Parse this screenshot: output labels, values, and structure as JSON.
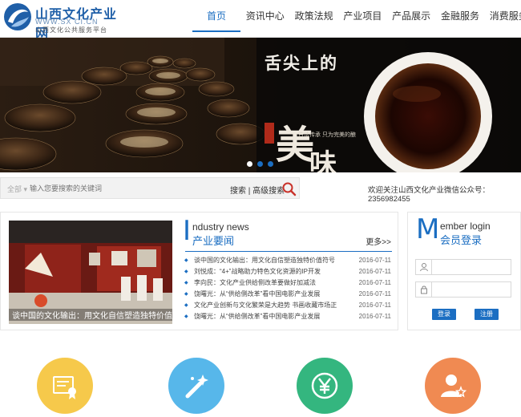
{
  "colors": {
    "accent": "#1b6ec2",
    "circle_yellow": "#f6c94b",
    "circle_blue": "#57b7ea",
    "circle_green": "#34b67f",
    "circle_orange": "#f08a52"
  },
  "header": {
    "logo_cn": "山西文化产业网",
    "logo_url": "WWW.SX CI.CN",
    "logo_sub": "山西文化公共服务平台",
    "nav": [
      {
        "label": "首页",
        "active": true
      },
      {
        "label": "资讯中心"
      },
      {
        "label": "政策法规"
      },
      {
        "label": "产业项目"
      },
      {
        "label": "产品展示"
      },
      {
        "label": "金融服务"
      },
      {
        "label": "消费服务"
      }
    ]
  },
  "banner": {
    "title": "舌尖上的",
    "slogan": "古法传承 只为完美的酿",
    "big1": "美",
    "big2": "味",
    "dots": 3,
    "active_dot": 1
  },
  "search": {
    "category": "全部",
    "placeholder": "输入您要搜索的关键词",
    "search_label": "搜索",
    "advanced_label": "高级搜索",
    "wechat_notice": "欢迎关注山西文化产业微信公众号：2356982455"
  },
  "news": {
    "big_letter": "I",
    "en_title": "ndustry news",
    "cn_title": "产业要闻",
    "more": "更多>>",
    "photo_caption": "谈中国的文化输出：用文化自信塑造独特价值符号",
    "items": [
      {
        "title": "谈中国的文化输出：用文化自信塑造独特价值符号",
        "date": "2016-07-11"
      },
      {
        "title": "刘悦成：“4+”战略助力特色文化资源的IP开发",
        "date": "2016-07-11"
      },
      {
        "title": "李向民：文化产业供给侧改革要做好加减法",
        "date": "2016-07-11"
      },
      {
        "title": "饶曙光：从“供给侧改革”看中国电影产业发展",
        "date": "2016-07-11"
      },
      {
        "title": "文化产业创新与文化繁荣是大趋势 书画收藏市场正",
        "date": "2016-07-11"
      },
      {
        "title": "饶曙光：从“供给侧改革”看中国电影产业发展",
        "date": "2016-07-11"
      }
    ]
  },
  "member": {
    "big_letter": "M",
    "en_title": "ember login",
    "cn_title": "会员登录",
    "login_label": "登录",
    "register_label": "注册"
  },
  "services": [
    {
      "icon": "certificate-icon"
    },
    {
      "icon": "magic-wand-icon"
    },
    {
      "icon": "yen-icon"
    },
    {
      "icon": "user-star-icon"
    }
  ]
}
